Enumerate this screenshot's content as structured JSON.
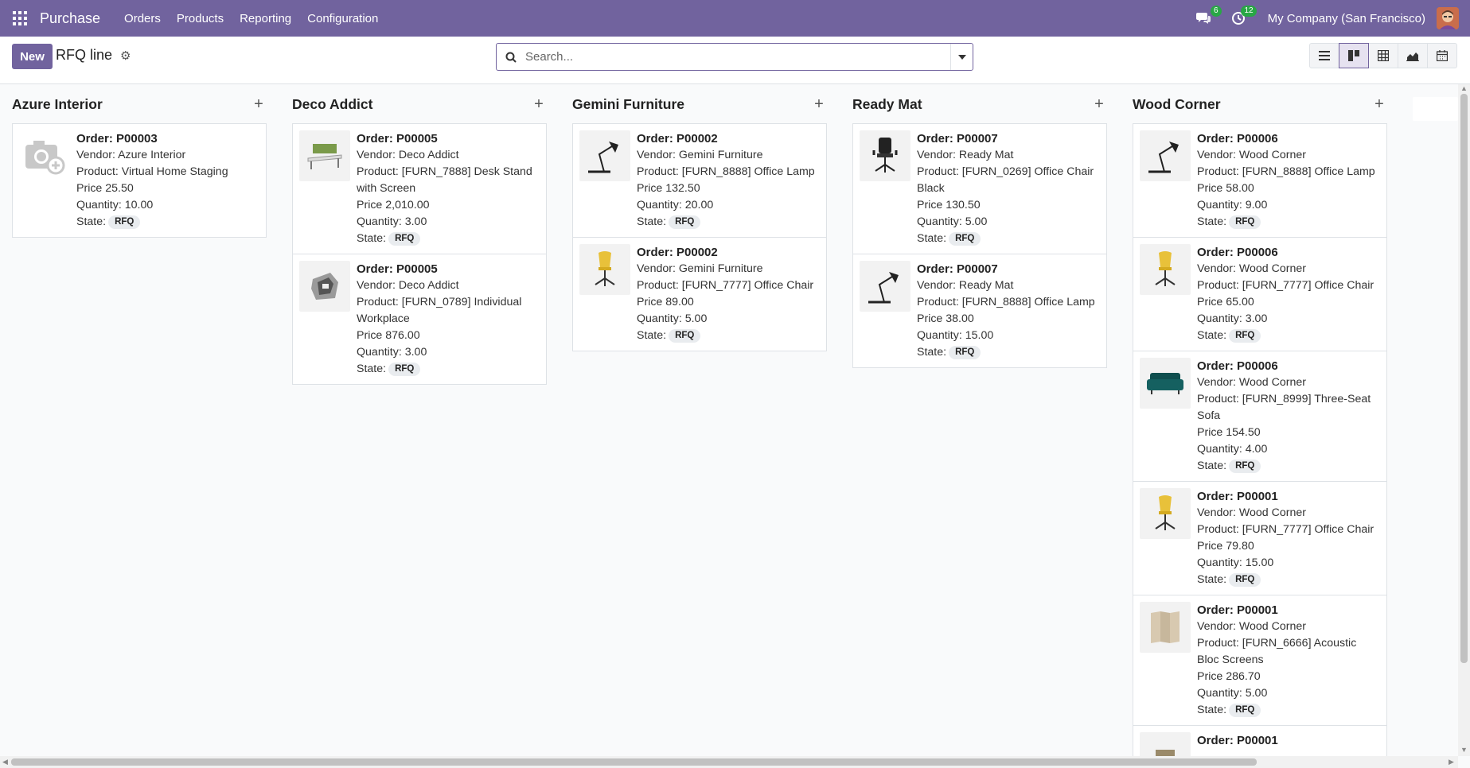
{
  "navbar": {
    "app_name": "Purchase",
    "menu": [
      "Orders",
      "Products",
      "Reporting",
      "Configuration"
    ],
    "messages_count": "6",
    "activities_count": "12",
    "company": "My Company (San Francisco)"
  },
  "control_panel": {
    "new_label": "New",
    "title": "RFQ line",
    "search_placeholder": "Search...",
    "views": [
      "list-icon",
      "kanban-icon",
      "pivot-icon",
      "graph-icon",
      "calendar-icon"
    ],
    "active_view": "kanban-icon"
  },
  "columns": [
    {
      "title": "Azure Interior",
      "cards": [
        {
          "order": "Order: P00003",
          "vendor": "Vendor: Azure Interior",
          "product": "Product: Virtual Home Staging",
          "price": "Price 25.50",
          "quantity": "Quantity: 10.00",
          "state_label": "State:",
          "state": "RFQ",
          "image": "camera-placeholder-icon"
        }
      ]
    },
    {
      "title": "Deco Addict",
      "cards": [
        {
          "order": "Order: P00005",
          "vendor": "Vendor: Deco Addict",
          "product": "Product: [FURN_7888] Desk Stand with Screen",
          "price": "Price 2,010.00",
          "quantity": "Quantity: 3.00",
          "state_label": "State:",
          "state": "RFQ",
          "image": "desk-stand-icon"
        },
        {
          "order": "Order: P00005",
          "vendor": "Vendor: Deco Addict",
          "product": "Product: [FURN_0789] Individual Workplace",
          "price": "Price 876.00",
          "quantity": "Quantity: 3.00",
          "state_label": "State:",
          "state": "RFQ",
          "image": "workplace-icon"
        }
      ]
    },
    {
      "title": "Gemini Furniture",
      "cards": [
        {
          "order": "Order: P00002",
          "vendor": "Vendor: Gemini Furniture",
          "product": "Product: [FURN_8888] Office Lamp",
          "price": "Price 132.50",
          "quantity": "Quantity: 20.00",
          "state_label": "State:",
          "state": "RFQ",
          "image": "lamp-icon"
        },
        {
          "order": "Order: P00002",
          "vendor": "Vendor: Gemini Furniture",
          "product": "Product: [FURN_7777] Office Chair",
          "price": "Price 89.00",
          "quantity": "Quantity: 5.00",
          "state_label": "State:",
          "state": "RFQ",
          "image": "yellow-chair-icon"
        }
      ]
    },
    {
      "title": "Ready Mat",
      "cards": [
        {
          "order": "Order: P00007",
          "vendor": "Vendor: Ready Mat",
          "product": "Product: [FURN_0269] Office Chair Black",
          "price": "Price 130.50",
          "quantity": "Quantity: 5.00",
          "state_label": "State:",
          "state": "RFQ",
          "image": "black-chair-icon"
        },
        {
          "order": "Order: P00007",
          "vendor": "Vendor: Ready Mat",
          "product": "Product: [FURN_8888] Office Lamp",
          "price": "Price 38.00",
          "quantity": "Quantity: 15.00",
          "state_label": "State:",
          "state": "RFQ",
          "image": "lamp-icon"
        }
      ]
    },
    {
      "title": "Wood Corner",
      "cards": [
        {
          "order": "Order: P00006",
          "vendor": "Vendor: Wood Corner",
          "product": "Product: [FURN_8888] Office Lamp",
          "price": "Price 58.00",
          "quantity": "Quantity: 9.00",
          "state_label": "State:",
          "state": "RFQ",
          "image": "lamp-icon"
        },
        {
          "order": "Order: P00006",
          "vendor": "Vendor: Wood Corner",
          "product": "Product: [FURN_7777] Office Chair",
          "price": "Price 65.00",
          "quantity": "Quantity: 3.00",
          "state_label": "State:",
          "state": "RFQ",
          "image": "yellow-chair-icon"
        },
        {
          "order": "Order: P00006",
          "vendor": "Vendor: Wood Corner",
          "product": "Product: [FURN_8999] Three-Seat Sofa",
          "price": "Price 154.50",
          "quantity": "Quantity: 4.00",
          "state_label": "State:",
          "state": "RFQ",
          "image": "sofa-icon"
        },
        {
          "order": "Order: P00001",
          "vendor": "Vendor: Wood Corner",
          "product": "Product: [FURN_7777] Office Chair",
          "price": "Price 79.80",
          "quantity": "Quantity: 15.00",
          "state_label": "State:",
          "state": "RFQ",
          "image": "yellow-chair-icon"
        },
        {
          "order": "Order: P00001",
          "vendor": "Vendor: Wood Corner",
          "product": "Product: [FURN_6666] Acoustic Bloc Screens",
          "price": "Price 286.70",
          "quantity": "Quantity: 5.00",
          "state_label": "State:",
          "state": "RFQ",
          "image": "screens-icon"
        },
        {
          "order": "Order: P00001",
          "vendor": "",
          "product": "",
          "price": "",
          "quantity": "",
          "state_label": "",
          "state": "",
          "image": "box-icon"
        }
      ]
    }
  ]
}
